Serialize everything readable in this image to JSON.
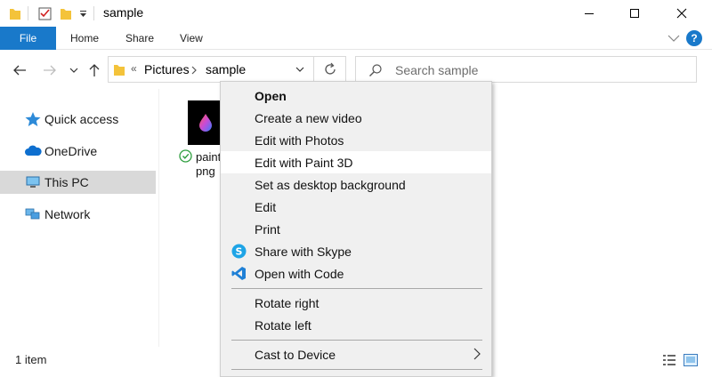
{
  "window": {
    "title": "sample",
    "controls": [
      "minimize",
      "maximize",
      "close"
    ]
  },
  "ribbon": {
    "tabs": [
      {
        "label": "File",
        "active": true
      },
      {
        "label": "Home"
      },
      {
        "label": "Share"
      },
      {
        "label": "View"
      }
    ],
    "help_label": "?"
  },
  "address": {
    "overflow": "«",
    "crumbs": [
      "Pictures",
      "sample"
    ]
  },
  "search": {
    "placeholder": "Search sample"
  },
  "nav": {
    "items": [
      {
        "label": "Quick access",
        "icon": "star-icon"
      },
      {
        "label": "OneDrive",
        "icon": "cloud-icon"
      },
      {
        "label": "This PC",
        "icon": "computer-icon",
        "selected": true
      },
      {
        "label": "Network",
        "icon": "network-icon"
      }
    ]
  },
  "file": {
    "name_line1": "paint",
    "name_line2": "png"
  },
  "status": {
    "count": "1 item"
  },
  "context_menu": {
    "items": [
      {
        "label": "Open",
        "bold": true
      },
      {
        "label": "Create a new video"
      },
      {
        "label": "Edit with Photos"
      },
      {
        "label": "Edit with Paint 3D",
        "highlighted": true
      },
      {
        "label": "Set as desktop background"
      },
      {
        "label": "Edit"
      },
      {
        "label": "Print"
      },
      {
        "label": "Share with Skype",
        "icon": "skype-icon"
      },
      {
        "label": "Open with Code",
        "icon": "vscode-icon"
      },
      {
        "label": "Rotate right"
      },
      {
        "label": "Rotate left"
      },
      {
        "label": "Cast to Device",
        "submenu": true
      }
    ]
  },
  "colors": {
    "accent": "#1979ca",
    "menu_bg": "#f0f0f0",
    "selection": "#d9d9d9"
  }
}
